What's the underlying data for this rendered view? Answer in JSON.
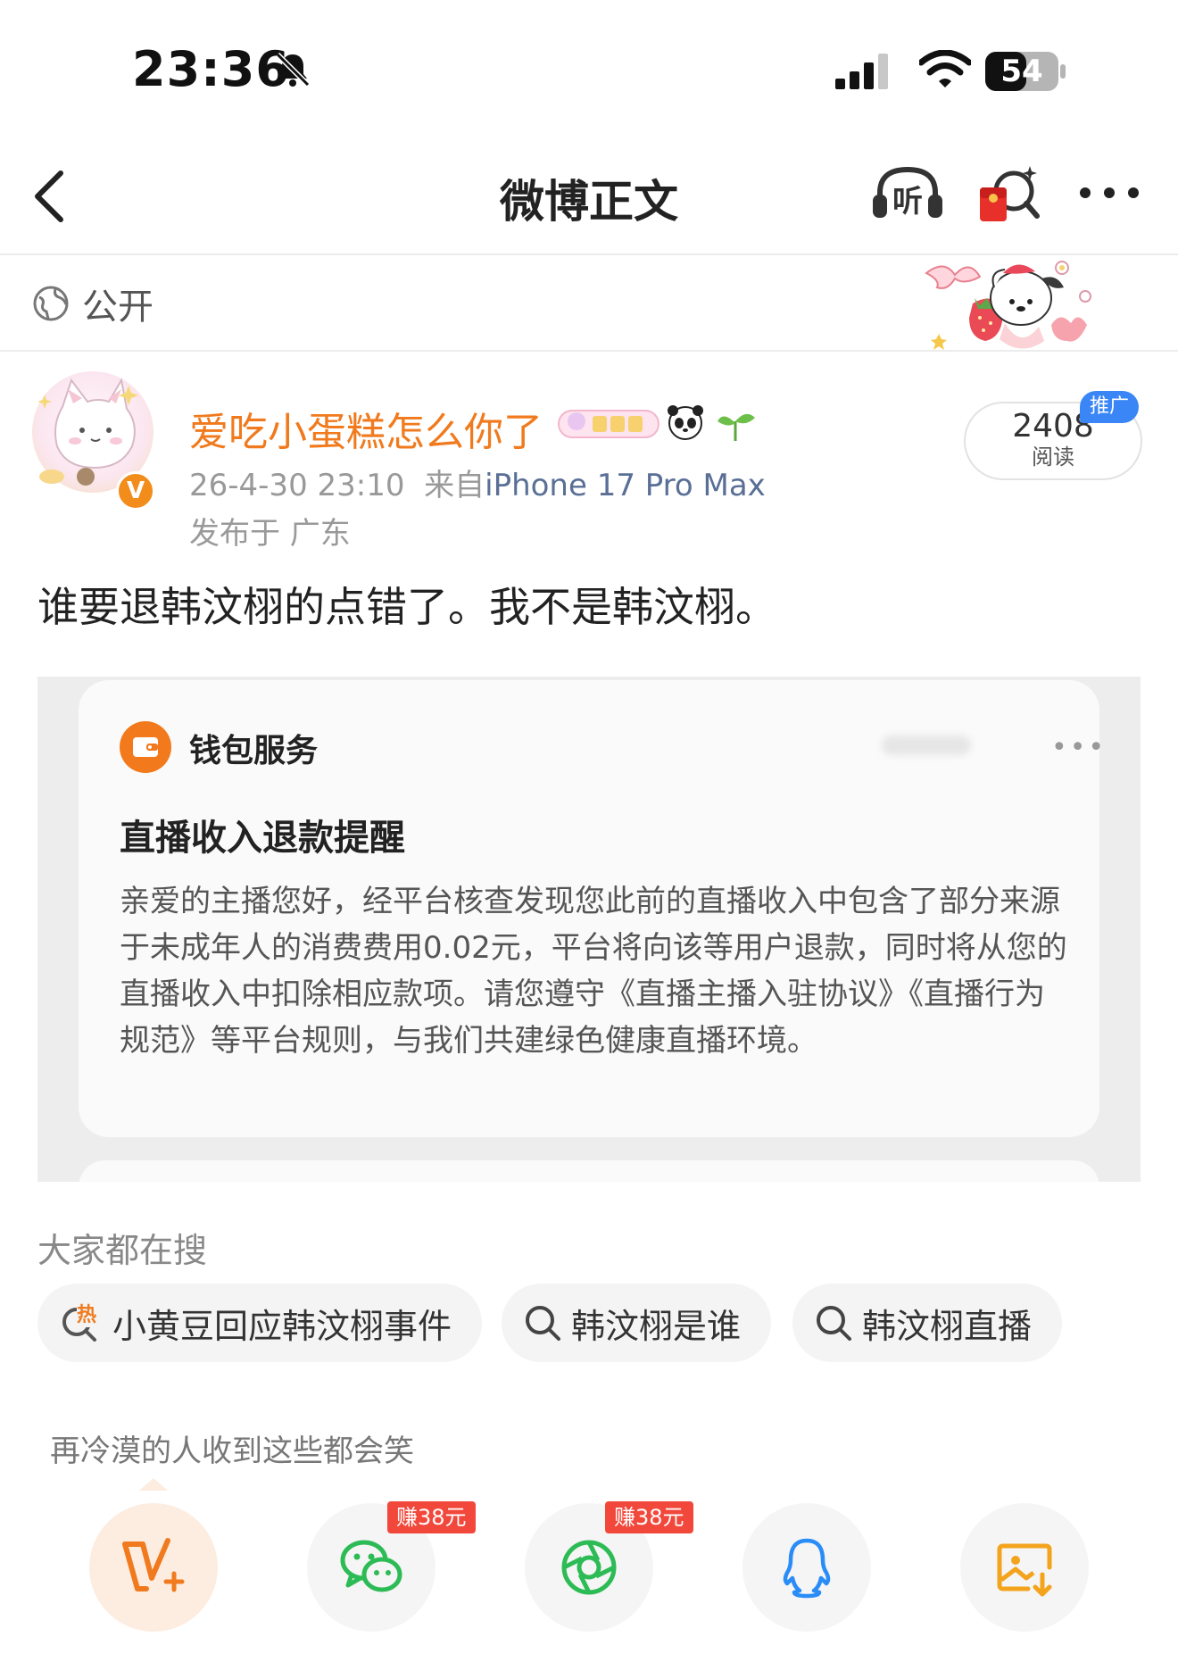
{
  "status_bar": {
    "time": "23:36",
    "battery": "54"
  },
  "nav": {
    "title": "微博正文",
    "listen_label": "听"
  },
  "visibility": {
    "label": "公开"
  },
  "author": {
    "name": "爱吃小蛋糕怎么你了",
    "verified_mark": "V",
    "date": "26-4-30 23:10",
    "source_prefix": "来自",
    "device": "iPhone 17 Pro Max",
    "location": "发布于 广东"
  },
  "stats": {
    "reads": "2408",
    "reads_label": "阅读",
    "promo_label": "推广"
  },
  "post": {
    "text": "谁要退韩汶栩的点错了。我不是韩汶栩。"
  },
  "image_card": {
    "service_label": "钱包服务",
    "more": "•••",
    "title": "直播收入退款提醒",
    "body": "亲爱的主播您好，经平台核查发现您此前的直播收入中包含了部分来源于未成年人的消费费用0.02元，平台将向该等用户退款，同时将从您的直播收入中扣除相应款项。请您遵守《直播主播入驻协议》《直播行为规范》等平台规则，与我们共建绿色健康直播环境。"
  },
  "hot_search": {
    "title": "大家都在搜",
    "hot_badge": "热",
    "items": [
      {
        "label": "小黄豆回应韩汶栩事件",
        "icon": "hot-search-icon"
      },
      {
        "label": "韩汶栩是谁",
        "icon": "search-icon"
      },
      {
        "label": "韩汶栩直播",
        "icon": "search-icon"
      }
    ]
  },
  "share": {
    "title": "再冷漠的人收到这些都会笑",
    "earn_badge_1": "赚38元",
    "earn_badge_2": "赚38元",
    "targets": [
      "weibo-v-icon",
      "wechat-icon",
      "moments-icon",
      "qq-icon",
      "save-image-icon"
    ]
  },
  "colors": {
    "accent_orange": "#f07a1d",
    "device_link": "#5a6f96",
    "promo_blue": "#3a86f7",
    "earn_red": "#f2483b",
    "wechat_green": "#2dbb55"
  }
}
